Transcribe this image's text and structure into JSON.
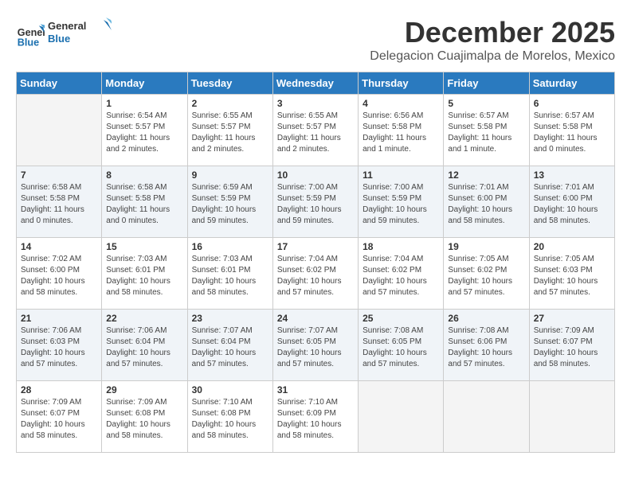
{
  "logo": {
    "line1": "General",
    "line2": "Blue"
  },
  "title": "December 2025",
  "subtitle": "Delegacion Cuajimalpa de Morelos, Mexico",
  "headers": [
    "Sunday",
    "Monday",
    "Tuesday",
    "Wednesday",
    "Thursday",
    "Friday",
    "Saturday"
  ],
  "weeks": [
    [
      {
        "day": "",
        "info": ""
      },
      {
        "day": "1",
        "info": "Sunrise: 6:54 AM\nSunset: 5:57 PM\nDaylight: 11 hours\nand 2 minutes."
      },
      {
        "day": "2",
        "info": "Sunrise: 6:55 AM\nSunset: 5:57 PM\nDaylight: 11 hours\nand 2 minutes."
      },
      {
        "day": "3",
        "info": "Sunrise: 6:55 AM\nSunset: 5:57 PM\nDaylight: 11 hours\nand 2 minutes."
      },
      {
        "day": "4",
        "info": "Sunrise: 6:56 AM\nSunset: 5:58 PM\nDaylight: 11 hours\nand 1 minute."
      },
      {
        "day": "5",
        "info": "Sunrise: 6:57 AM\nSunset: 5:58 PM\nDaylight: 11 hours\nand 1 minute."
      },
      {
        "day": "6",
        "info": "Sunrise: 6:57 AM\nSunset: 5:58 PM\nDaylight: 11 hours\nand 0 minutes."
      }
    ],
    [
      {
        "day": "7",
        "info": "Sunrise: 6:58 AM\nSunset: 5:58 PM\nDaylight: 11 hours\nand 0 minutes."
      },
      {
        "day": "8",
        "info": "Sunrise: 6:58 AM\nSunset: 5:58 PM\nDaylight: 11 hours\nand 0 minutes."
      },
      {
        "day": "9",
        "info": "Sunrise: 6:59 AM\nSunset: 5:59 PM\nDaylight: 10 hours\nand 59 minutes."
      },
      {
        "day": "10",
        "info": "Sunrise: 7:00 AM\nSunset: 5:59 PM\nDaylight: 10 hours\nand 59 minutes."
      },
      {
        "day": "11",
        "info": "Sunrise: 7:00 AM\nSunset: 5:59 PM\nDaylight: 10 hours\nand 59 minutes."
      },
      {
        "day": "12",
        "info": "Sunrise: 7:01 AM\nSunset: 6:00 PM\nDaylight: 10 hours\nand 58 minutes."
      },
      {
        "day": "13",
        "info": "Sunrise: 7:01 AM\nSunset: 6:00 PM\nDaylight: 10 hours\nand 58 minutes."
      }
    ],
    [
      {
        "day": "14",
        "info": "Sunrise: 7:02 AM\nSunset: 6:00 PM\nDaylight: 10 hours\nand 58 minutes."
      },
      {
        "day": "15",
        "info": "Sunrise: 7:03 AM\nSunset: 6:01 PM\nDaylight: 10 hours\nand 58 minutes."
      },
      {
        "day": "16",
        "info": "Sunrise: 7:03 AM\nSunset: 6:01 PM\nDaylight: 10 hours\nand 58 minutes."
      },
      {
        "day": "17",
        "info": "Sunrise: 7:04 AM\nSunset: 6:02 PM\nDaylight: 10 hours\nand 57 minutes."
      },
      {
        "day": "18",
        "info": "Sunrise: 7:04 AM\nSunset: 6:02 PM\nDaylight: 10 hours\nand 57 minutes."
      },
      {
        "day": "19",
        "info": "Sunrise: 7:05 AM\nSunset: 6:02 PM\nDaylight: 10 hours\nand 57 minutes."
      },
      {
        "day": "20",
        "info": "Sunrise: 7:05 AM\nSunset: 6:03 PM\nDaylight: 10 hours\nand 57 minutes."
      }
    ],
    [
      {
        "day": "21",
        "info": "Sunrise: 7:06 AM\nSunset: 6:03 PM\nDaylight: 10 hours\nand 57 minutes."
      },
      {
        "day": "22",
        "info": "Sunrise: 7:06 AM\nSunset: 6:04 PM\nDaylight: 10 hours\nand 57 minutes."
      },
      {
        "day": "23",
        "info": "Sunrise: 7:07 AM\nSunset: 6:04 PM\nDaylight: 10 hours\nand 57 minutes."
      },
      {
        "day": "24",
        "info": "Sunrise: 7:07 AM\nSunset: 6:05 PM\nDaylight: 10 hours\nand 57 minutes."
      },
      {
        "day": "25",
        "info": "Sunrise: 7:08 AM\nSunset: 6:05 PM\nDaylight: 10 hours\nand 57 minutes."
      },
      {
        "day": "26",
        "info": "Sunrise: 7:08 AM\nSunset: 6:06 PM\nDaylight: 10 hours\nand 57 minutes."
      },
      {
        "day": "27",
        "info": "Sunrise: 7:09 AM\nSunset: 6:07 PM\nDaylight: 10 hours\nand 58 minutes."
      }
    ],
    [
      {
        "day": "28",
        "info": "Sunrise: 7:09 AM\nSunset: 6:07 PM\nDaylight: 10 hours\nand 58 minutes."
      },
      {
        "day": "29",
        "info": "Sunrise: 7:09 AM\nSunset: 6:08 PM\nDaylight: 10 hours\nand 58 minutes."
      },
      {
        "day": "30",
        "info": "Sunrise: 7:10 AM\nSunset: 6:08 PM\nDaylight: 10 hours\nand 58 minutes."
      },
      {
        "day": "31",
        "info": "Sunrise: 7:10 AM\nSunset: 6:09 PM\nDaylight: 10 hours\nand 58 minutes."
      },
      {
        "day": "",
        "info": ""
      },
      {
        "day": "",
        "info": ""
      },
      {
        "day": "",
        "info": ""
      }
    ]
  ]
}
